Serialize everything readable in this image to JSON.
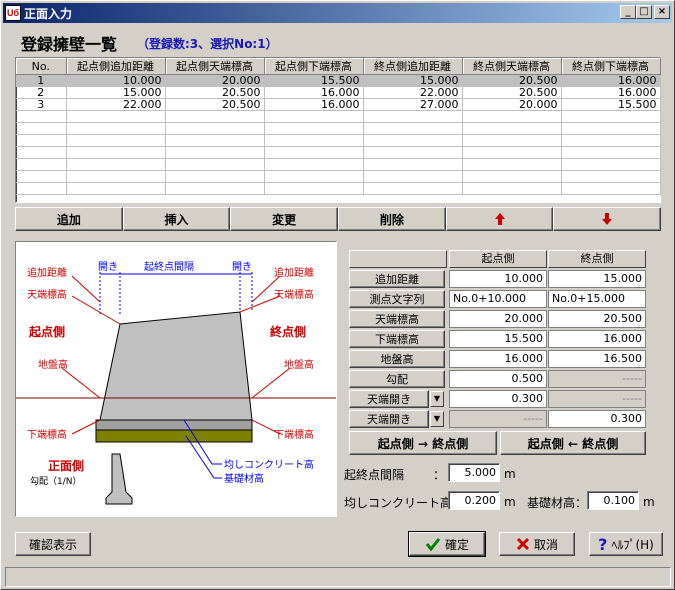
{
  "window": {
    "title": "正面入力",
    "icon_text": "Uб",
    "minimize": "_",
    "maximize": "□",
    "close": "×"
  },
  "heading": "登録擁壁一覧",
  "subheading": "（登録数:3、選択No:1）",
  "grid": {
    "columns": [
      "No.",
      "起点側追加距離",
      "起点側天端標高",
      "起点側下端標高",
      "終点側追加距離",
      "終点側天端標高",
      "終点側下端標高"
    ],
    "rows": [
      [
        "1",
        "10.000",
        "20.000",
        "15.500",
        "15.000",
        "20.500",
        "16.000"
      ],
      [
        "2",
        "15.000",
        "20.500",
        "16.000",
        "22.000",
        "20.500",
        "16.000"
      ],
      [
        "3",
        "22.000",
        "20.500",
        "16.000",
        "27.000",
        "20.000",
        "15.500"
      ]
    ]
  },
  "actions": {
    "add": "追加",
    "insert": "挿入",
    "change": "変更",
    "delete": "削除"
  },
  "diagram": {
    "add_dist_left": "追加距離",
    "add_dist_right": "追加距離",
    "top_elev_left": "天端標高",
    "top_elev_right": "天端標高",
    "start_side": "起点側",
    "end_side": "終点側",
    "ground_left": "地盤高",
    "ground_right": "地盤高",
    "bottom_elev_left": "下端標高",
    "bottom_elev_right": "下端標高",
    "opening_left": "開き",
    "opening_right": "開き",
    "span": "起終点間隔",
    "front_side": "正面側",
    "slope_note": "勾配（1/N）",
    "leveling_concrete": "均しコンクリート高",
    "base_material": "基礎材高"
  },
  "form": {
    "col_start": "起点側",
    "col_end": "終点側",
    "rows": [
      {
        "label": "追加距離",
        "start": "10.000",
        "end": "15.000"
      },
      {
        "label": "測点文字列",
        "start": "No.0+10.000",
        "end": "No.0+15.000"
      },
      {
        "label": "天端標高",
        "start": "20.000",
        "end": "20.500"
      },
      {
        "label": "下端標高",
        "start": "15.500",
        "end": "16.000"
      },
      {
        "label": "地盤高",
        "start": "16.000",
        "end": "16.500"
      },
      {
        "label": "勾配",
        "start": "0.500",
        "end": "-----"
      },
      {
        "label": "天端開き",
        "start": "0.300",
        "end": "-----"
      },
      {
        "label": "天端開き",
        "start": "-----",
        "end": "0.300"
      }
    ],
    "copy_to_end": "起点側 → 終点側",
    "copy_to_start": "起点側 ← 終点側",
    "span_label": "起終点間隔",
    "span_colon": "：",
    "span_value": "5.000",
    "span_unit": "m",
    "leveling_label": "均しコンクリート高：",
    "leveling_value": "0.200",
    "leveling_unit": "m",
    "base_label": "基礎材高：",
    "base_value": "0.100",
    "base_unit": "m"
  },
  "footer": {
    "confirm_display": "確認表示",
    "ok": "確定",
    "cancel": "取消",
    "help": "ﾍﾙﾌﾟ(H)"
  },
  "colors": {
    "label_red": "#cc0000",
    "link_blue": "#1a1ab8",
    "wall_gray": "#c0c0c0",
    "base_olive": "#808000"
  }
}
